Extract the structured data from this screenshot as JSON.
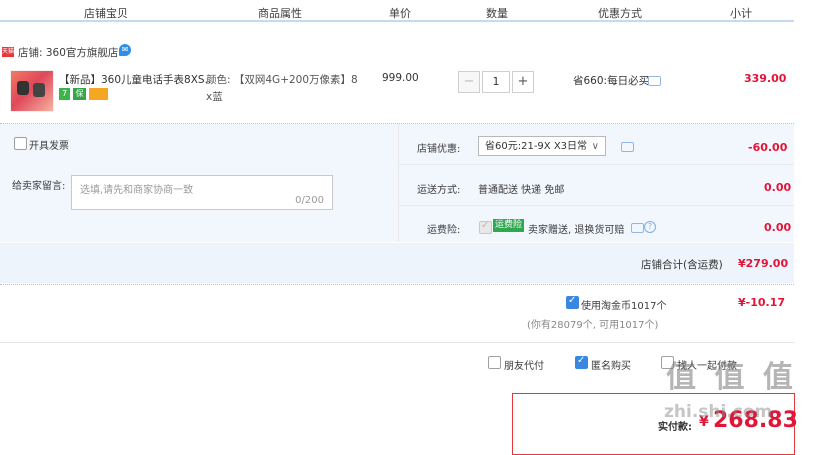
{
  "table_header": {
    "col_item": "店铺宝贝",
    "col_attr": "商品属性",
    "col_price": "单价",
    "col_qty": "数量",
    "col_promo": "优惠方式",
    "col_subtotal": "小计"
  },
  "shop": {
    "badge": "天猫",
    "name": "店铺: 360官方旗舰店"
  },
  "item": {
    "title": "【新品】360儿童电话手表8XS...",
    "attr_line1": "颜色: 【双网4G+200万像素】8",
    "attr_line2": "x蓝",
    "price": "999.00",
    "qty_minus": "−",
    "qty": "1",
    "qty_plus": "+",
    "promo": "省660:每日必买",
    "subtotal": "339.00",
    "chip_7": "7",
    "chip_b": "保"
  },
  "invoice": {
    "label": "开具发票"
  },
  "memo": {
    "label": "给卖家留言:",
    "placeholder": "选填,请先和商家协商一致",
    "counter": "0/200"
  },
  "shop_discount": {
    "label": "店铺优惠:",
    "selected": "省60元:21-9X X3日常",
    "amount": "-60.00"
  },
  "shipping": {
    "label": "运送方式:",
    "value": "普通配送 快递 免邮",
    "amount": "0.00"
  },
  "freight_insurance": {
    "label": "运费险:",
    "tag": "运费险",
    "value": "卖家赠送, 退换货可赔",
    "amount": "0.00"
  },
  "shop_total": {
    "label": "店铺合计(含运费)",
    "amount": "¥279.00"
  },
  "coins": {
    "label": "使用淘金币1017个",
    "amount": "¥-10.17",
    "note": "(你有28079个, 可用1017个)"
  },
  "options": {
    "friend_pay": "朋友代付",
    "anonymous": "匿名购买",
    "third": "找人一起付款"
  },
  "pay": {
    "label": "实付款:",
    "currency": "¥",
    "amount": "268.83"
  },
  "watermark": {
    "glyphs": "值 值 值",
    "site": "zhi.shi.com"
  },
  "colors": {
    "accent_red": "#e31436",
    "accent_blue": "#3a87e0",
    "band_blue": "#f2f7fd"
  }
}
